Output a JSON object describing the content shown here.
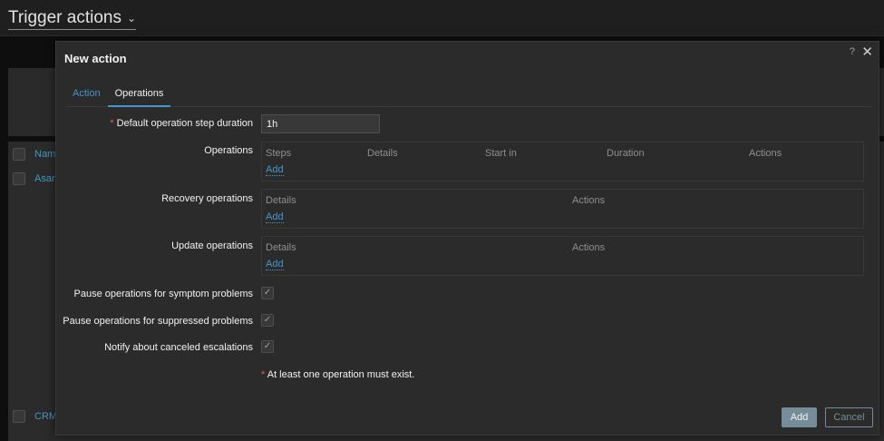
{
  "page": {
    "title": "Trigger actions",
    "bg_rows": [
      "Name",
      "Asan",
      "CRM"
    ]
  },
  "modal": {
    "title": "New action",
    "help": "?",
    "close": "✕",
    "tabs": [
      {
        "label": "Action",
        "active": false
      },
      {
        "label": "Operations",
        "active": true
      }
    ],
    "default_step_duration": {
      "label": "Default operation step duration",
      "required": true,
      "value": "1h"
    },
    "operations": {
      "label": "Operations",
      "columns": [
        "Steps",
        "Details",
        "Start in",
        "Duration",
        "Actions"
      ],
      "add_label": "Add"
    },
    "recovery_operations": {
      "label": "Recovery operations",
      "columns": [
        "Details",
        "Actions"
      ],
      "add_label": "Add"
    },
    "update_operations": {
      "label": "Update operations",
      "columns": [
        "Details",
        "Actions"
      ],
      "add_label": "Add"
    },
    "pause_symptom": {
      "label": "Pause operations for symptom problems",
      "checked": true
    },
    "pause_suppressed": {
      "label": "Pause operations for suppressed problems",
      "checked": true
    },
    "notify_canceled": {
      "label": "Notify about canceled escalations",
      "checked": true
    },
    "note": "At least one operation must exist.",
    "buttons": {
      "add": "Add",
      "cancel": "Cancel"
    }
  },
  "colors": {
    "accent_link": "#4796c4",
    "required": "#e45959",
    "button": "#768d99",
    "surface": "#2b2b2b"
  }
}
